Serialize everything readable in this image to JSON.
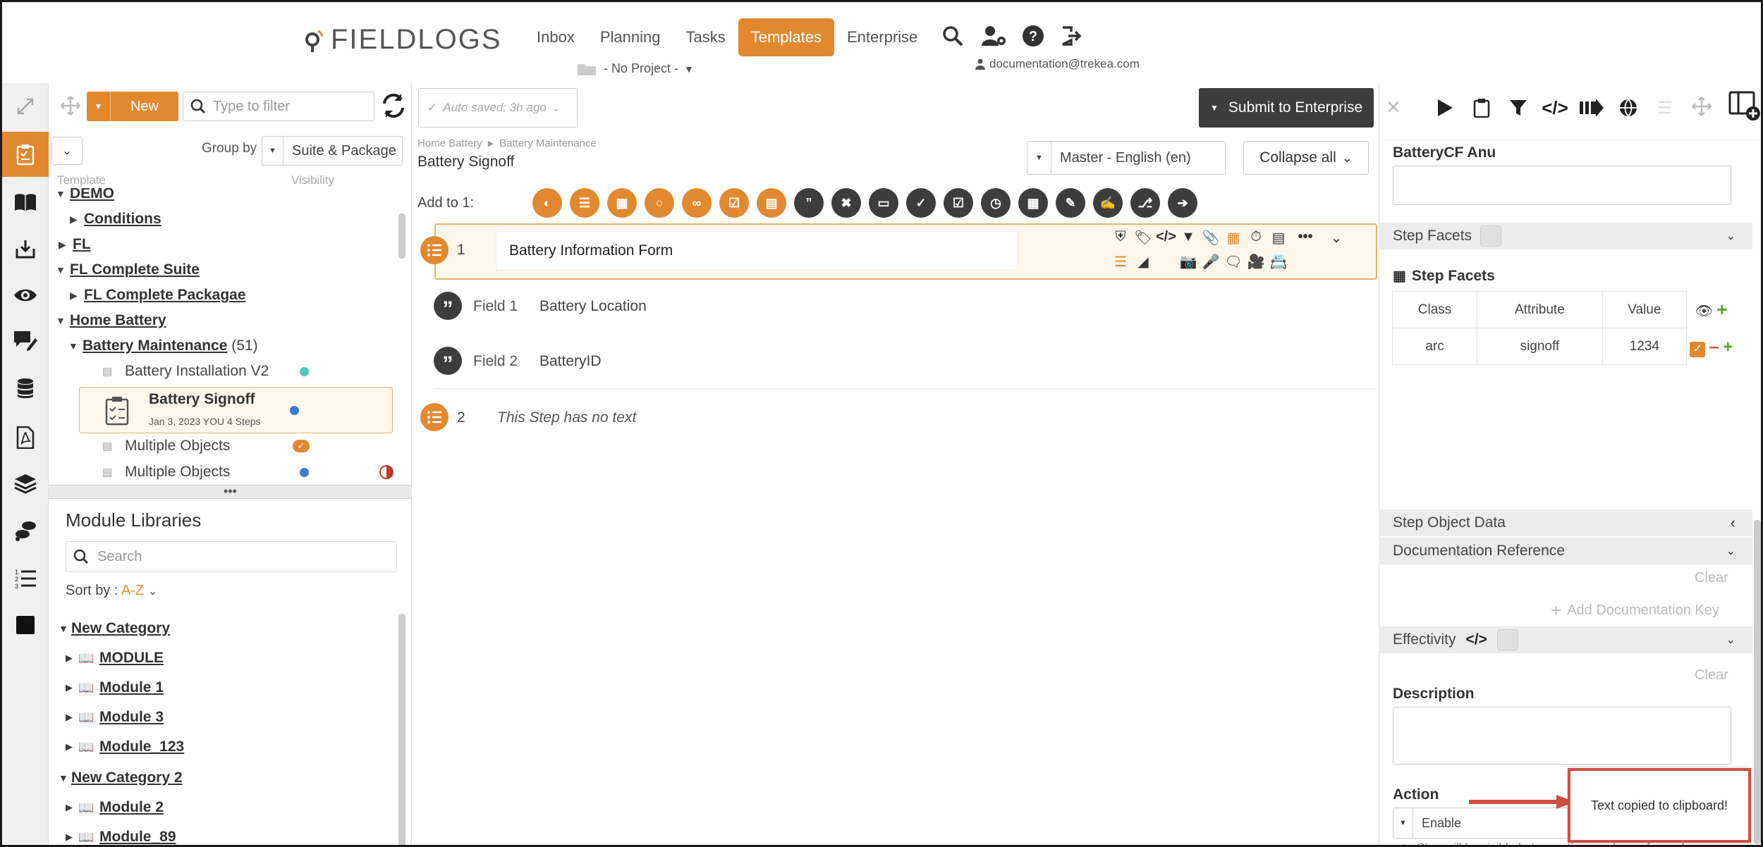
{
  "brand": {
    "logo_text": "FIELDLOGS",
    "accent": "#e2892f",
    "dark": "#3d3d3d"
  },
  "nav": {
    "items": [
      "Inbox",
      "Planning",
      "Tasks",
      "Templates",
      "Enterprise"
    ],
    "active": "Templates"
  },
  "project": {
    "label": "- No Project -"
  },
  "user": {
    "email": "documentation@trekea.com"
  },
  "left_panel": {
    "new_label": "New",
    "filter_placeholder": "Type to filter",
    "group_by_label": "Group by",
    "group_by_value": "Suite & Package",
    "col_template": "Template",
    "col_visibility": "Visibility",
    "tree": [
      {
        "label": "DEMO",
        "type": "link"
      },
      {
        "label": "Conditions",
        "type": "link"
      },
      {
        "label": "FL",
        "type": "link"
      },
      {
        "label": "FL Complete Suite",
        "type": "link"
      },
      {
        "label": "FL Complete Packagae",
        "type": "link"
      },
      {
        "label": "Home Battery",
        "type": "link"
      },
      {
        "label": "Battery Maintenance",
        "count": "(51)",
        "type": "link"
      },
      {
        "label": "Battery Installation V2",
        "type": "item",
        "status_color": "#4ec9c0"
      },
      {
        "label": "Battery Signoff",
        "meta": "Jan 3, 2023  YOU  4 Steps",
        "type": "selected",
        "status_color": "#3a7bd5"
      },
      {
        "label": "Multiple Objects",
        "type": "item",
        "status": "check"
      },
      {
        "label": "Multiple Objects",
        "type": "item",
        "status_color": "#3a7bd5",
        "extra": "half-circle"
      }
    ]
  },
  "modules": {
    "title": "Module Libraries",
    "search_placeholder": "Search",
    "sort_label": "Sort by : ",
    "sort_value": "A-Z",
    "items": [
      {
        "label": "New Category",
        "level": 0
      },
      {
        "label": "MODULE",
        "level": 1
      },
      {
        "label": "Module 1",
        "level": 1
      },
      {
        "label": "Module 3",
        "level": 1
      },
      {
        "label": "Module_123",
        "level": 1
      },
      {
        "label": "New Category 2",
        "level": 0
      },
      {
        "label": "Module 2",
        "level": 1
      },
      {
        "label": "Module_89",
        "level": 1
      }
    ]
  },
  "editor": {
    "autosave": "Auto saved: 3h ago",
    "submit": "Submit to Enterprise",
    "breadcrumb": [
      "Home Battery",
      "Battery Maintenance"
    ],
    "title": "Battery Signoff",
    "language": "Master - English (en)",
    "collapse": "Collapse all",
    "add_to": "Add to 1:",
    "steps": [
      {
        "num": "1",
        "title": "Battery Information Form"
      },
      {
        "num": "2",
        "title": "This Step has no text"
      }
    ],
    "fields": [
      {
        "label": "Field 1",
        "value": "Battery Location"
      },
      {
        "label": "Field 2",
        "value": "BatteryID"
      }
    ]
  },
  "right_panel": {
    "custom_field_label": "BatteryCF Anu",
    "step_facets_header": "Step Facets",
    "step_facets_title": "Step Facets",
    "table_headers": [
      "Class",
      "Attribute",
      "Value"
    ],
    "table_rows": [
      [
        "arc",
        "signoff",
        "1234"
      ]
    ],
    "step_object_data": "Step Object Data",
    "doc_reference": "Documentation Reference",
    "clear": "Clear",
    "add_doc_key": "Add Documentation Key",
    "effectivity": "Effectivity",
    "description": "Description",
    "action": "Action",
    "action_value": "Enable",
    "action_note": "Step will be visible but no action can be performed",
    "toast": "Text copied to clipboard!"
  }
}
